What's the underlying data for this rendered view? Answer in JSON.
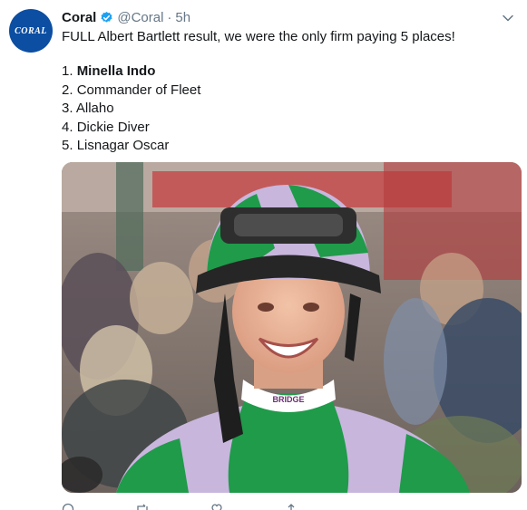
{
  "account": {
    "name": "Coral",
    "handle": "@Coral",
    "separator": "·",
    "time": "5h",
    "avatar_logo_text": "CORAL"
  },
  "tweet": {
    "text": "FULL Albert Bartlett result, we were the only firm paying 5 places!",
    "results": [
      {
        "pos": "1.",
        "name": "Minella Indo",
        "bold": true
      },
      {
        "pos": "2.",
        "name": "Commander of Fleet",
        "bold": false
      },
      {
        "pos": "3.",
        "name": "Allaho",
        "bold": false
      },
      {
        "pos": "4.",
        "name": "Dickie Diver",
        "bold": false
      },
      {
        "pos": "5.",
        "name": "Lisnagar Oscar",
        "bold": false
      }
    ]
  },
  "photo": {
    "brand_on_collar": "BRIDGE"
  },
  "colors": {
    "verified_blue": "#1da1f2",
    "avatar_blue": "#0b4ea2",
    "silk_green": "#1f9b4a",
    "silk_lilac": "#c8b6dd",
    "muted_text": "#657786"
  },
  "icons": [
    "verified-badge-icon",
    "chevron-down-icon",
    "reply-icon",
    "retweet-icon",
    "like-icon",
    "share-icon"
  ]
}
